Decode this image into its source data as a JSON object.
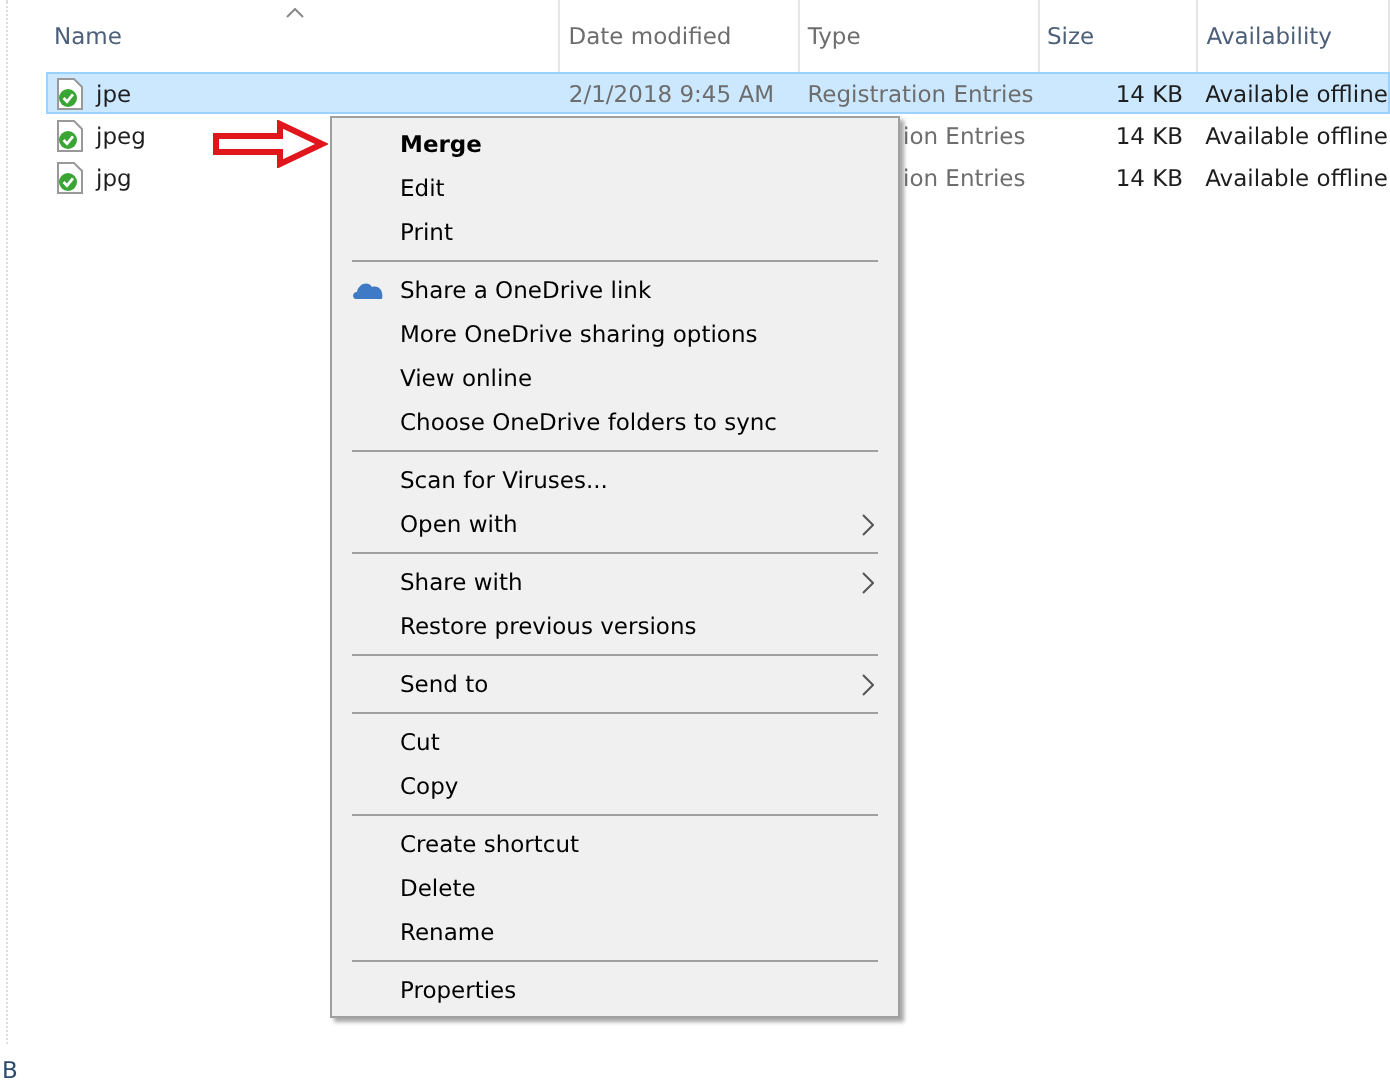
{
  "columns": [
    {
      "label": "Name",
      "sorted": true
    },
    {
      "label": "Date modified",
      "sorted": false
    },
    {
      "label": "Type",
      "sorted": false
    },
    {
      "label": "Size",
      "sorted": false
    },
    {
      "label": "Availability",
      "sorted": false
    }
  ],
  "rows": [
    {
      "name": "jpe",
      "date": "2/1/2018 9:45 AM",
      "type": "Registration Entries",
      "type_partial": false,
      "size": "14 KB",
      "availability": "Available offline",
      "selected": true
    },
    {
      "name": "jpeg",
      "type": "ion Entries",
      "type_partial": true,
      "size": "14 KB",
      "availability": "Available offline",
      "selected": false
    },
    {
      "name": "jpg",
      "type": "ion Entries",
      "type_partial": true,
      "size": "14 KB",
      "availability": "Available offline",
      "selected": false
    }
  ],
  "menu": [
    {
      "kind": "default",
      "label": "Merge"
    },
    {
      "kind": "item",
      "label": "Edit"
    },
    {
      "kind": "item",
      "label": "Print"
    },
    {
      "kind": "separator"
    },
    {
      "kind": "cloud",
      "label": "Share a OneDrive link"
    },
    {
      "kind": "item",
      "label": "More OneDrive sharing options"
    },
    {
      "kind": "item",
      "label": "View online"
    },
    {
      "kind": "item",
      "label": "Choose OneDrive folders to sync"
    },
    {
      "kind": "separator"
    },
    {
      "kind": "item",
      "label": "Scan for Viruses..."
    },
    {
      "kind": "submenu",
      "label": "Open with"
    },
    {
      "kind": "separator"
    },
    {
      "kind": "submenu",
      "label": "Share with"
    },
    {
      "kind": "item",
      "label": "Restore previous versions"
    },
    {
      "kind": "separator"
    },
    {
      "kind": "submenu",
      "label": "Send to"
    },
    {
      "kind": "separator"
    },
    {
      "kind": "item",
      "label": "Cut"
    },
    {
      "kind": "item",
      "label": "Copy"
    },
    {
      "kind": "separator"
    },
    {
      "kind": "item",
      "label": "Create shortcut"
    },
    {
      "kind": "item",
      "label": "Delete"
    },
    {
      "kind": "item",
      "label": "Rename"
    },
    {
      "kind": "separator"
    },
    {
      "kind": "item",
      "label": "Properties"
    }
  ],
  "status_bar": {
    "text": "B"
  }
}
